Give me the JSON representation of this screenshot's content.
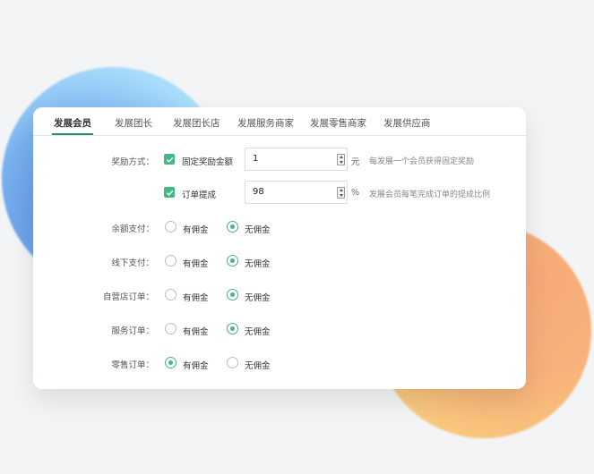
{
  "tabs": [
    {
      "label": "发展会员"
    },
    {
      "label": "发展团长"
    },
    {
      "label": "发展团长店"
    },
    {
      "label": "发展服务商家"
    },
    {
      "label": "发展零售商家"
    },
    {
      "label": "发展供应商"
    }
  ],
  "reward": {
    "label": "奖励方式：",
    "fixed": {
      "checkbox_label": "固定奖励金额",
      "checked": true,
      "value": "1",
      "unit": "元",
      "hint": "每发展一个会员获得固定奖励"
    },
    "percent": {
      "checkbox_label": "订单提成",
      "checked": true,
      "value": "98",
      "unit": "%",
      "hint": "发展会员每笔完成订单的提成比例"
    }
  },
  "options": {
    "yes_label": "有佣金",
    "no_label": "无佣金"
  },
  "rows": [
    {
      "label": "余额支付：",
      "selected": "no"
    },
    {
      "label": "线下支付：",
      "selected": "no"
    },
    {
      "label": "自营店订单：",
      "selected": "no"
    },
    {
      "label": "服务订单：",
      "selected": "no"
    },
    {
      "label": "零售订单：",
      "selected": "yes"
    }
  ],
  "colors": {
    "accent": "#42b883",
    "tab_underline": "#2d8a6a"
  }
}
